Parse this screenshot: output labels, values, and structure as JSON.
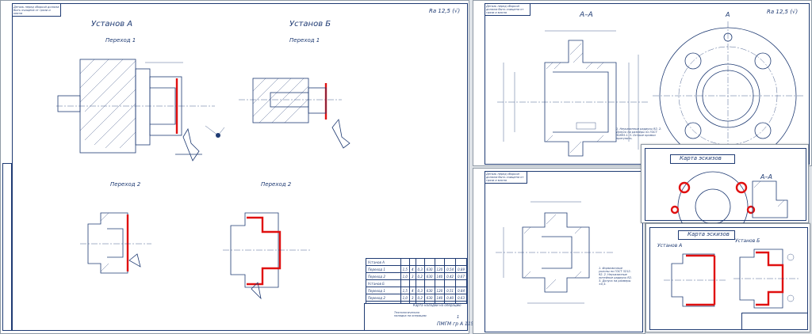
{
  "sheet1": {
    "stamp": "Деталь перед сборкой должна быть очищена от грязи и масла",
    "roughness": "Ra 12,5 (√)",
    "setup_a": "Установ А",
    "setup_b": "Установ Б",
    "a_pass1": "Переход 1",
    "a_pass2": "Переход 2",
    "b_pass1": "Переход 1",
    "b_pass2": "Переход 2",
    "table_headers": [
      "Наименование перехода",
      "t",
      "i",
      "S",
      "n",
      "v",
      "T₀",
      "Tшт"
    ],
    "table_rows": [
      [
        "Установ А",
        "",
        "",
        "",
        "",
        "",
        "",
        ""
      ],
      [
        "Переход 1",
        "1,5",
        "4",
        "0,3",
        "630",
        "120",
        "0,54",
        "0,89"
      ],
      [
        "Переход 2",
        "1,0",
        "3",
        "0,2",
        "630",
        "140",
        "0,42",
        "0,67"
      ],
      [
        "Установ Б",
        "",
        "",
        "",
        "",
        "",
        "",
        ""
      ],
      [
        "Переход 1",
        "1,5",
        "4",
        "0,3",
        "630",
        "120",
        "0,51",
        "0,84"
      ],
      [
        "Переход 2",
        "1,0",
        "3",
        "0,2",
        "630",
        "140",
        "0,40",
        "0,63"
      ]
    ],
    "title_block": {
      "doc_title": "Карта наладки на операцию",
      "part": "Технологическая наладка на операцию",
      "code": "ПМГМ гр А 115",
      "sheet_no": "1"
    }
  },
  "sheet2": {
    "stamp": "Деталь перед сборкой должна быть очищена от грязи и масла",
    "roughness": "Ra 12,5 (√)",
    "section": "А–А",
    "view_mark": "А",
    "notes": "1. Неуказанные радиусы R2. 2. Допуск на размеры по ГОСТ 30893.1. 3. Острые кромки притупить."
  },
  "sheet3": {
    "stamp": "Деталь перед сборкой должна быть очищена от грязи и масла",
    "notes": "1. Формовочные уклоны по ГОСТ 3212-92. 2. Неуказанные литейные радиусы R2. 3. Допуск на размеры ±0,5."
  },
  "sheet4": {
    "title": "Карта эскизов",
    "section": "А–А"
  },
  "sheet5": {
    "title": "Карта эскизов",
    "setup_a": "Установ А",
    "setup_b": "Установ Б"
  }
}
